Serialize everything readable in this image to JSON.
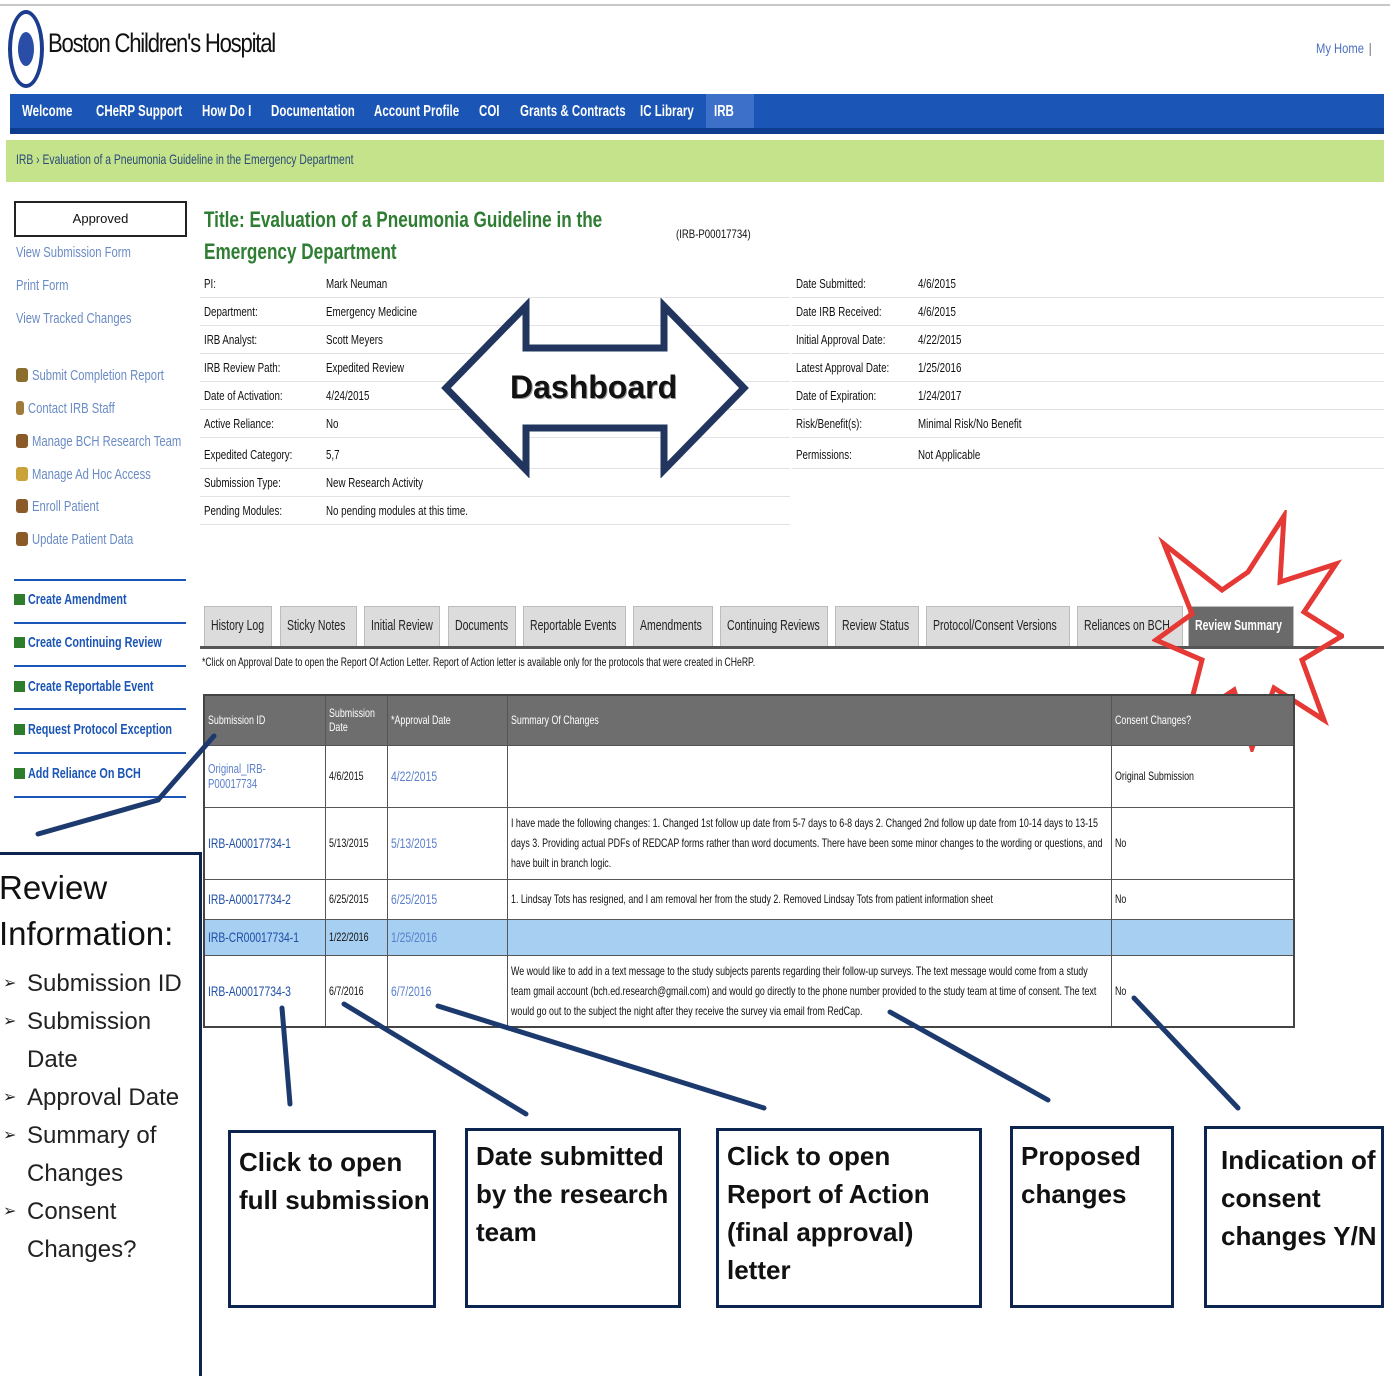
{
  "header": {
    "logo_text": "Boston Children's Hospital",
    "top_right": "My Home",
    "top_right_sep": "|"
  },
  "nav": [
    "Welcome",
    "CHeRP Support",
    "How Do I",
    "Documentation",
    "Account Profile",
    "COI",
    "Grants & Contracts",
    "IC Library",
    "IRB"
  ],
  "breadcrumb": "IRB › Evaluation of a Pneumonia Guideline in the Emergency Department",
  "sidebar": {
    "status": "Approved",
    "links": [
      "View Submission Form",
      "Print Form",
      "View Tracked Changes"
    ],
    "actions": [
      "Submit Completion Report",
      "Contact IRB Staff",
      "Manage BCH Research Team",
      "Manage Ad Hoc Access",
      "Enroll Patient",
      "Update Patient Data"
    ],
    "create": [
      "Create Amendment",
      "Create Continuing Review",
      "Create Reportable Event",
      "Request Protocol Exception",
      "Add Reliance On BCH"
    ]
  },
  "study": {
    "title": "Title: Evaluation of a Pneumonia Guideline in the Emergency Department",
    "irb_number": "(IRB-P00017734)",
    "left_fields": [
      {
        "label": "PI:",
        "value": "Mark Neuman"
      },
      {
        "label": "Department:",
        "value": "Emergency Medicine"
      },
      {
        "label": "IRB Analyst:",
        "value": "Scott Meyers"
      },
      {
        "label": "IRB Review Path:",
        "value": "Expedited Review"
      },
      {
        "label": "Date of Activation:",
        "value": "4/24/2015"
      },
      {
        "label": "Active Reliance:",
        "value": "No"
      },
      {
        "label": "Expedited Category:",
        "value": "5,7"
      },
      {
        "label": "Submission Type:",
        "value": "New Research Activity"
      },
      {
        "label": "Pending Modules:",
        "value": "No pending modules at this time."
      }
    ],
    "right_fields": [
      {
        "label": "Date Submitted:",
        "value": "4/6/2015"
      },
      {
        "label": "Date IRB Received:",
        "value": "4/6/2015"
      },
      {
        "label": "Initial Approval Date:",
        "value": "4/22/2015"
      },
      {
        "label": "Latest Approval Date:",
        "value": "1/25/2016"
      },
      {
        "label": "Date of Expiration:",
        "value": "1/24/2017"
      },
      {
        "label": "Risk/Benefit(s):",
        "value": "Minimal Risk/No Benefit"
      },
      {
        "label": "Permissions:",
        "value": "Not Applicable"
      }
    ]
  },
  "dashboard_label": "Dashboard",
  "tabs": [
    "History Log",
    "Sticky Notes",
    "Initial Review",
    "Documents",
    "Reportable Events",
    "Amendments",
    "Continuing Reviews",
    "Review Status",
    "Protocol/Consent Versions",
    "Reliances on BCH",
    "Review Summary"
  ],
  "tab_note": "*Click on Approval Date to open the Report Of Action Letter. Report of Action letter is available only for the protocols that were created in CHeRP.",
  "table": {
    "headers": [
      "Submission ID",
      "Submission Date",
      "*Approval Date",
      "Summary Of Changes",
      "Consent Changes?"
    ],
    "rows": [
      {
        "id": "Original_IRB-P00017734",
        "date": "4/6/2015",
        "approval": "4/22/2015",
        "summary": "",
        "consent": "Original Submission"
      },
      {
        "id": "IRB-A00017734-1",
        "date": "5/13/2015",
        "approval": "5/13/2015",
        "summary": "I have made the following changes: 1. Changed 1st follow up date from 5-7 days to 6-8 days 2. Changed 2nd follow up date from 10-14 days to 13-15 days 3. Providing actual PDFs of REDCAP forms rather than word documents. There have been some minor changes to the wording or questions, and have built in branch logic.",
        "consent": "No"
      },
      {
        "id": "IRB-A00017734-2",
        "date": "6/25/2015",
        "approval": "6/25/2015",
        "summary": "1. Lindsay Tots has resigned, and I am removal her from the study 2. Removed Lindsay Tots from patient information sheet",
        "consent": "No"
      },
      {
        "id": "IRB-CR00017734-1",
        "date": "1/22/2016",
        "approval": "1/25/2016",
        "summary": "",
        "consent": ""
      },
      {
        "id": "IRB-A00017734-3",
        "date": "6/7/2016",
        "approval": "6/7/2016",
        "summary": "We would like to add in a text message to the study subjects parents regarding their follow-up surveys. The text message would come from a study team gmail account (bch.ed.research@gmail.com) and would go directly to the phone number provided to the study team at time of consent. The text would go out to the subject the night after they receive the survey via email from RedCap.",
        "consent": "No"
      }
    ]
  },
  "callouts": {
    "review_title": "Review Information:",
    "review_items": [
      "Submission ID",
      "Submission Date",
      "Approval Date",
      "Summary of Changes",
      "Consent Changes?"
    ],
    "boxes": [
      "Click to open full submission",
      "Date submitted by the research team",
      "Click to open Report of Action (final approval) letter",
      "Proposed changes",
      "Indication of consent changes Y/N"
    ]
  },
  "colors": {
    "nav": "#1b55b5",
    "breadcrumb": "#c4e38b",
    "title": "#2e7d32",
    "highlight_row": "#a7cff1",
    "callout_border": "#0c2550",
    "burst": "#e53935"
  }
}
